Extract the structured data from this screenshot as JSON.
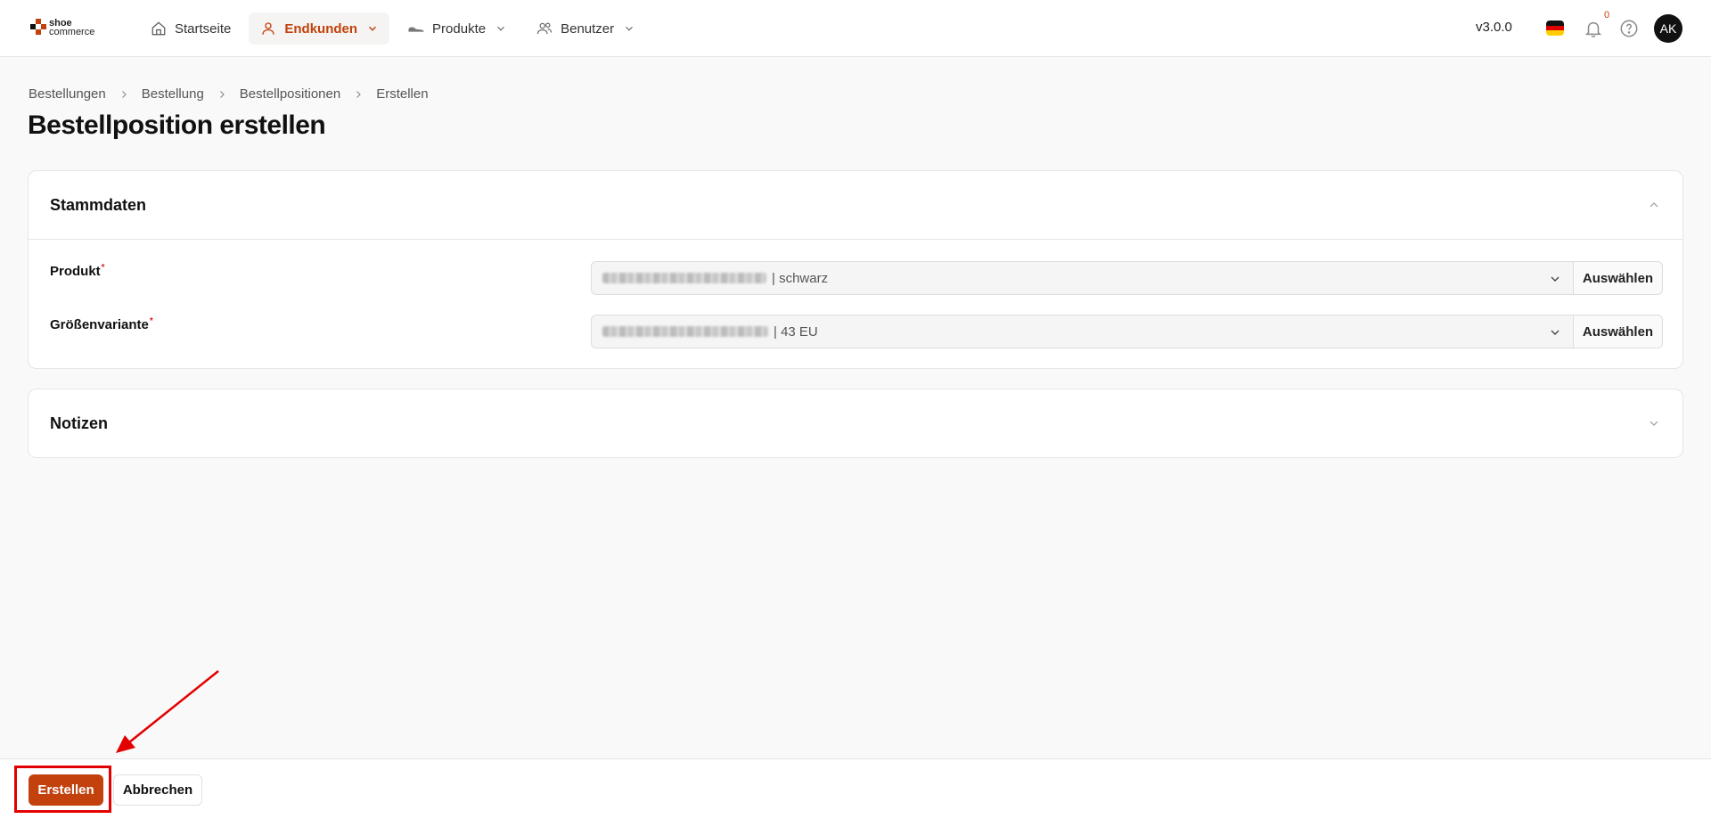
{
  "header": {
    "logo": {
      "line1": "shoe",
      "line2": "commerce"
    },
    "nav": [
      {
        "label": "Startseite",
        "icon": "home-icon",
        "active": false,
        "dropdown": false
      },
      {
        "label": "Endkunden",
        "icon": "user-icon",
        "active": true,
        "dropdown": true
      },
      {
        "label": "Produkte",
        "icon": "shoe-icon",
        "active": false,
        "dropdown": true
      },
      {
        "label": "Benutzer",
        "icon": "users-icon",
        "active": false,
        "dropdown": true
      }
    ],
    "version": "v3.0.0",
    "language_icon": "germany-flag-icon",
    "notification_count": "0",
    "avatar_initials": "AK"
  },
  "breadcrumb": [
    "Bestellungen",
    "Bestellung",
    "Bestellpositionen",
    "Erstellen"
  ],
  "page_title": "Bestellposition erstellen",
  "sections": {
    "master_data": {
      "title": "Stammdaten",
      "fields": {
        "product": {
          "label": "Produkt",
          "value": "| schwarz",
          "button": "Auswählen"
        },
        "size_variant": {
          "label": "Größenvariante",
          "value": "| 43 EU",
          "button": "Auswählen"
        }
      }
    },
    "notes": {
      "title": "Notizen"
    }
  },
  "footer": {
    "create_label": "Erstellen",
    "cancel_label": "Abbrechen"
  },
  "colors": {
    "accent": "#c2410c",
    "annotation": "#e30000"
  }
}
